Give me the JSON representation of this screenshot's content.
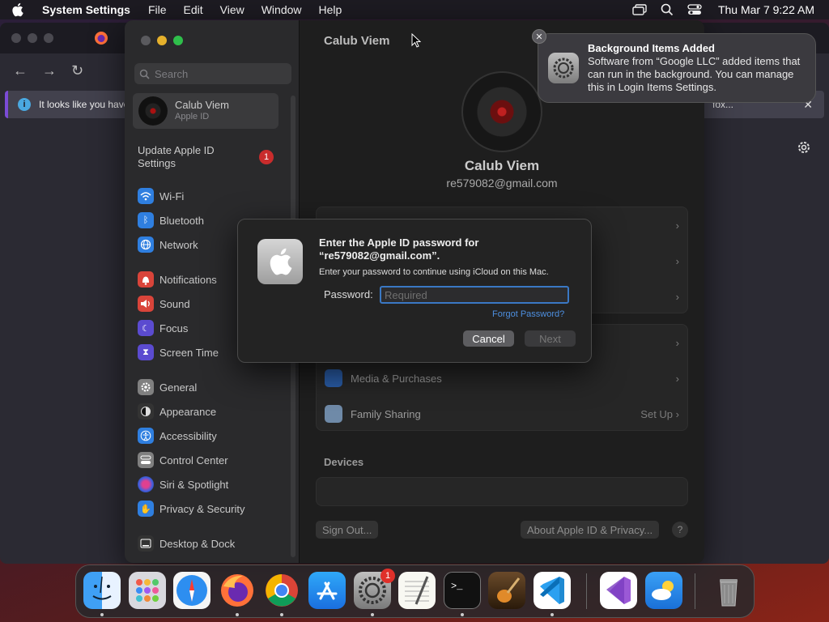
{
  "menubar": {
    "app_name": "System Settings",
    "items": [
      "File",
      "Edit",
      "View",
      "Window",
      "Help"
    ],
    "clock": "Thu Mar 7  9:22 AM"
  },
  "browser": {
    "notice_text": "It looks like you have",
    "notice_tail": "fox..."
  },
  "sidebar": {
    "search_placeholder": "Search",
    "account_name": "Calub Viem",
    "account_sub": "Apple ID",
    "update_label": "Update Apple ID Settings",
    "update_badge": "1",
    "items": [
      {
        "label": "Wi-Fi",
        "color": "#2f7fe0",
        "icon": "wifi-icon"
      },
      {
        "label": "Bluetooth",
        "color": "#2f7fe0",
        "icon": "bluetooth-icon"
      },
      {
        "label": "Network",
        "color": "#2f7fe0",
        "icon": "globe-icon"
      },
      {
        "label": "Notifications",
        "color": "#d9443a",
        "icon": "bell-icon"
      },
      {
        "label": "Sound",
        "color": "#d9443a",
        "icon": "speaker-icon"
      },
      {
        "label": "Focus",
        "color": "#5b4bd0",
        "icon": "moon-icon"
      },
      {
        "label": "Screen Time",
        "color": "#5b4bd0",
        "icon": "hourglass-icon"
      },
      {
        "label": "General",
        "color": "#808080",
        "icon": "gear-icon"
      },
      {
        "label": "Appearance",
        "color": "#333333",
        "icon": "appearance-icon"
      },
      {
        "label": "Accessibility",
        "color": "#2f7fe0",
        "icon": "accessibility-icon"
      },
      {
        "label": "Control Center",
        "color": "#808080",
        "icon": "control-center-icon"
      },
      {
        "label": "Siri & Spotlight",
        "color": "#b040c0",
        "icon": "siri-icon"
      },
      {
        "label": "Privacy & Security",
        "color": "#2f7fe0",
        "icon": "hand-icon"
      },
      {
        "label": "Desktop & Dock",
        "color": "#333333",
        "icon": "dock-icon"
      }
    ]
  },
  "main": {
    "title": "Calub Viem",
    "user_name": "Calub Viem",
    "email": "re579082@gmail.com",
    "media_label": "Media & Purchases",
    "family_label": "Family Sharing",
    "family_action": "Set Up",
    "devices_label": "Devices",
    "sign_out": "Sign Out...",
    "about": "About Apple ID & Privacy...",
    "help": "?"
  },
  "dialog": {
    "title": "Enter the Apple ID password for “re579082@gmail.com”.",
    "desc": "Enter your password to continue using iCloud on this Mac.",
    "password_label": "Password:",
    "password_placeholder": "Required",
    "forgot": "Forgot Password?",
    "cancel": "Cancel",
    "next": "Next"
  },
  "notification": {
    "title": "Background Items Added",
    "body": "Software from “Google LLC” added items that can run in the background. You can manage this in Login Items Settings."
  },
  "dock": {
    "settings_badge": "1"
  }
}
